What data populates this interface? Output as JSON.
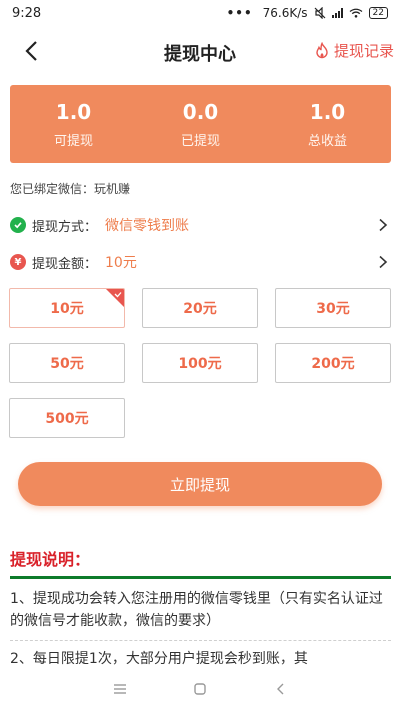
{
  "status": {
    "time": "9:28",
    "dots": "•••",
    "speed": "76.6K/s",
    "battery": "22"
  },
  "header": {
    "title": "提现中心",
    "record_label": "提现记录"
  },
  "stats": [
    {
      "value": "1.0",
      "label": "可提现"
    },
    {
      "value": "0.0",
      "label": "已提现"
    },
    {
      "value": "1.0",
      "label": "总收益"
    }
  ],
  "bind_info": "您已绑定微信：玩机赚",
  "method": {
    "label": "提现方式：",
    "value": "微信零钱到账"
  },
  "amount_row": {
    "label": "提现金额：",
    "value": "10元"
  },
  "amounts": [
    "10元",
    "20元",
    "30元",
    "50元",
    "100元",
    "200元",
    "500元"
  ],
  "selected_amount": "10元",
  "submit_label": "立即提现",
  "explain": {
    "title": "提现说明：",
    "items": [
      "1、提现成功会转入您注册用的微信零钱里（只有实名认证过的微信号才能收款，微信的要求）",
      "2、每日限提1次，大部分用户提现会秒到账，其"
    ]
  },
  "colors": {
    "accent": "#f08a5d",
    "amount_text": "#ee6a4a",
    "title_red": "#d9222a",
    "rule_green": "#0d7b2a"
  },
  "icons": [
    "back-arrow-icon",
    "fire-icon",
    "wechat-check-icon",
    "yen-icon",
    "chevron-right-icon",
    "menu-icon",
    "home-icon",
    "back-icon"
  ]
}
